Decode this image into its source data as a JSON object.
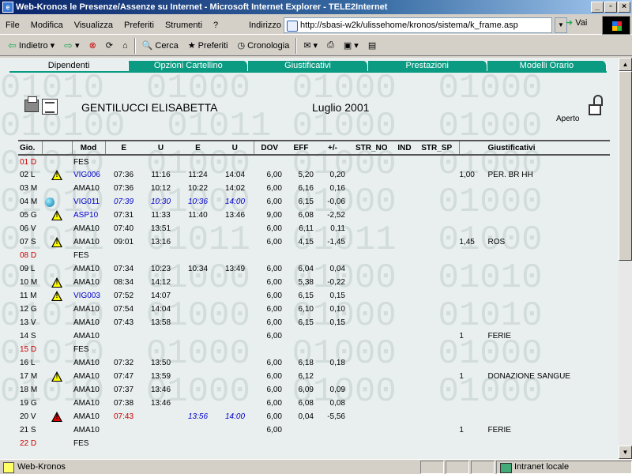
{
  "window": {
    "title": "Web-Kronos le Presenze/Assenze su Internet - Microsoft Internet Explorer - TELE2Internet",
    "min": "_",
    "max": "▫",
    "close": "×"
  },
  "menu": [
    "File",
    "Modifica",
    "Visualizza",
    "Preferiti",
    "Strumenti",
    "?"
  ],
  "address": {
    "label": "Indirizzo",
    "url": "http://sbasi-w2k/ulissehome/kronos/sistema/k_frame.asp",
    "go": "Vai"
  },
  "toolbar": {
    "back": "Indietro",
    "search": "Cerca",
    "favorites": "Preferiti",
    "history": "Cronologia"
  },
  "tabs": [
    "Dipendenti",
    "Opzioni Cartellino",
    "Giustificativi",
    "Prestazioni",
    "Modelli Orario"
  ],
  "header": {
    "employee": "GENTILUCCI ELISABETTA",
    "period": "Luglio 2001",
    "state": "Aperto"
  },
  "background_text": [
    "01010  01000  01000  01000",
    "010100  01011 01000  01000",
    "01010  01000  01000  01000",
    "01010  01000  01000  01000",
    "01011  01011  01011  01000",
    "01010  01000  01000  01010",
    "01010  01000  01000  01010",
    "01010  01000  01000  01000",
    "01010  01000  01000  01000"
  ],
  "columns": [
    "Gio.",
    "",
    "Mod",
    "E",
    "U",
    "E",
    "U",
    "DOV",
    "EFF",
    "+/-",
    "STR_NO",
    "IND",
    "STR_SP",
    "",
    "Giustificativi"
  ],
  "rows": [
    {
      "day": "01 D",
      "red": true,
      "icon": "",
      "mod": "FES",
      "modBlue": false,
      "e1": "",
      "u1": "",
      "e2": "",
      "u2": "",
      "dov": "",
      "eff": "",
      "diff": "",
      "qty": "",
      "giust": ""
    },
    {
      "day": "02 L",
      "red": false,
      "icon": "warn-y",
      "mod": "VIG006",
      "modBlue": true,
      "e1": "07:36",
      "u1": "11:16",
      "e2": "11:24",
      "u2": "14:04",
      "dov": "6,00",
      "eff": "5,20",
      "diff": "0,20",
      "qty": "1,00",
      "giust": "PER. BR HH"
    },
    {
      "day": "03 M",
      "red": false,
      "icon": "",
      "mod": "AMA10",
      "modBlue": false,
      "e1": "07:36",
      "u1": "10:12",
      "e2": "10:22",
      "u2": "14:02",
      "dov": "6,00",
      "eff": "6,16",
      "diff": "0,16",
      "qty": "",
      "giust": ""
    },
    {
      "day": "04 M",
      "red": false,
      "icon": "globe",
      "mod": "VIG011",
      "modBlue": true,
      "e1": "07:39",
      "u1": "10:30",
      "e2": "10:36",
      "u2": "14:00",
      "dov": "6,00",
      "eff": "6,15",
      "diff": "-0,06",
      "qty": "",
      "giust": "",
      "italic": true
    },
    {
      "day": "05 G",
      "red": false,
      "icon": "warn-y",
      "mod": "ASP10",
      "modBlue": true,
      "e1": "07:31",
      "u1": "11:33",
      "e2": "11:40",
      "u2": "13:46",
      "dov": "9,00",
      "eff": "6,08",
      "diff": "-2,52",
      "qty": "",
      "giust": ""
    },
    {
      "day": "06 V",
      "red": false,
      "icon": "",
      "mod": "AMA10",
      "modBlue": false,
      "e1": "07:40",
      "u1": "13:51",
      "e2": "",
      "u2": "",
      "dov": "6,00",
      "eff": "6,11",
      "diff": "0,11",
      "qty": "",
      "giust": ""
    },
    {
      "day": "07 S",
      "red": false,
      "icon": "warn-y",
      "mod": "AMA10",
      "modBlue": false,
      "e1": "09:01",
      "u1": "13:16",
      "e2": "",
      "u2": "",
      "dov": "6,00",
      "eff": "4,15",
      "diff": "-1,45",
      "qty": "1,45",
      "giust": "ROS"
    },
    {
      "day": "08 D",
      "red": true,
      "icon": "",
      "mod": "FES",
      "modBlue": false,
      "e1": "",
      "u1": "",
      "e2": "",
      "u2": "",
      "dov": "",
      "eff": "",
      "diff": "",
      "qty": "",
      "giust": ""
    },
    {
      "day": "09 L",
      "red": false,
      "icon": "",
      "mod": "AMA10",
      "modBlue": false,
      "e1": "07:34",
      "u1": "10:23",
      "e2": "10:34",
      "u2": "13:49",
      "dov": "6,00",
      "eff": "6,04",
      "diff": "0,04",
      "qty": "",
      "giust": ""
    },
    {
      "day": "10 M",
      "red": false,
      "icon": "warn-y",
      "mod": "AMA10",
      "modBlue": false,
      "e1": "08:34",
      "u1": "14:12",
      "e2": "",
      "u2": "",
      "dov": "6,00",
      "eff": "5,38",
      "diff": "-0,22",
      "qty": "",
      "giust": ""
    },
    {
      "day": "11 M",
      "red": false,
      "icon": "warn-y",
      "mod": "VIG003",
      "modBlue": true,
      "e1": "07:52",
      "u1": "14:07",
      "e2": "",
      "u2": "",
      "dov": "6,00",
      "eff": "6,15",
      "diff": "0,15",
      "qty": "",
      "giust": ""
    },
    {
      "day": "12 G",
      "red": false,
      "icon": "",
      "mod": "AMA10",
      "modBlue": false,
      "e1": "07:54",
      "u1": "14:04",
      "e2": "",
      "u2": "",
      "dov": "6,00",
      "eff": "6,10",
      "diff": "0,10",
      "qty": "",
      "giust": ""
    },
    {
      "day": "13 V",
      "red": false,
      "icon": "",
      "mod": "AMA10",
      "modBlue": false,
      "e1": "07:43",
      "u1": "13:58",
      "e2": "",
      "u2": "",
      "dov": "6,00",
      "eff": "6,15",
      "diff": "0,15",
      "qty": "",
      "giust": ""
    },
    {
      "day": "14 S",
      "red": false,
      "icon": "",
      "mod": "AMA10",
      "modBlue": false,
      "e1": "",
      "u1": "",
      "e2": "",
      "u2": "",
      "dov": "6,00",
      "eff": "",
      "diff": "",
      "qty": "1",
      "giust": "FERIE"
    },
    {
      "day": "15 D",
      "red": true,
      "icon": "",
      "mod": "FES",
      "modBlue": false,
      "e1": "",
      "u1": "",
      "e2": "",
      "u2": "",
      "dov": "",
      "eff": "",
      "diff": "",
      "qty": "",
      "giust": ""
    },
    {
      "day": "16 L",
      "red": false,
      "icon": "",
      "mod": "AMA10",
      "modBlue": false,
      "e1": "07:32",
      "u1": "13:50",
      "e2": "",
      "u2": "",
      "dov": "6,00",
      "eff": "6,18",
      "diff": "0,18",
      "qty": "",
      "giust": ""
    },
    {
      "day": "17 M",
      "red": false,
      "icon": "warn-y",
      "mod": "AMA10",
      "modBlue": false,
      "e1": "07:47",
      "u1": "13:59",
      "e2": "",
      "u2": "",
      "dov": "6,00",
      "eff": "6,12",
      "diff": "",
      "qty": "1",
      "giust": "DONAZIONE SANGUE"
    },
    {
      "day": "18 M",
      "red": false,
      "icon": "",
      "mod": "AMA10",
      "modBlue": false,
      "e1": "07:37",
      "u1": "13:46",
      "e2": "",
      "u2": "",
      "dov": "6,00",
      "eff": "6,09",
      "diff": "0,09",
      "qty": "",
      "giust": ""
    },
    {
      "day": "19 G",
      "red": false,
      "icon": "",
      "mod": "AMA10",
      "modBlue": false,
      "e1": "07:38",
      "u1": "13:46",
      "e2": "",
      "u2": "",
      "dov": "6,00",
      "eff": "6,08",
      "diff": "0,08",
      "qty": "",
      "giust": ""
    },
    {
      "day": "20 V",
      "red": false,
      "icon": "warn-r",
      "mod": "AMA10",
      "modBlue": false,
      "e1": "07:43",
      "u1": "",
      "e2": "13:56",
      "u2": "14:00",
      "dov": "6,00",
      "eff": "0,04",
      "diff": "-5,56",
      "qty": "",
      "giust": "",
      "e1Red": true,
      "blueItalicE2": true
    },
    {
      "day": "21 S",
      "red": false,
      "icon": "",
      "mod": "AMA10",
      "modBlue": false,
      "e1": "",
      "u1": "",
      "e2": "",
      "u2": "",
      "dov": "6,00",
      "eff": "",
      "diff": "",
      "qty": "1",
      "giust": "FERIE"
    },
    {
      "day": "22 D",
      "red": true,
      "icon": "",
      "mod": "FES",
      "modBlue": false,
      "e1": "",
      "u1": "",
      "e2": "",
      "u2": "",
      "dov": "",
      "eff": "",
      "diff": "",
      "qty": "",
      "giust": ""
    }
  ],
  "status": {
    "text": "Web-Kronos",
    "zone": "Intranet locale"
  }
}
